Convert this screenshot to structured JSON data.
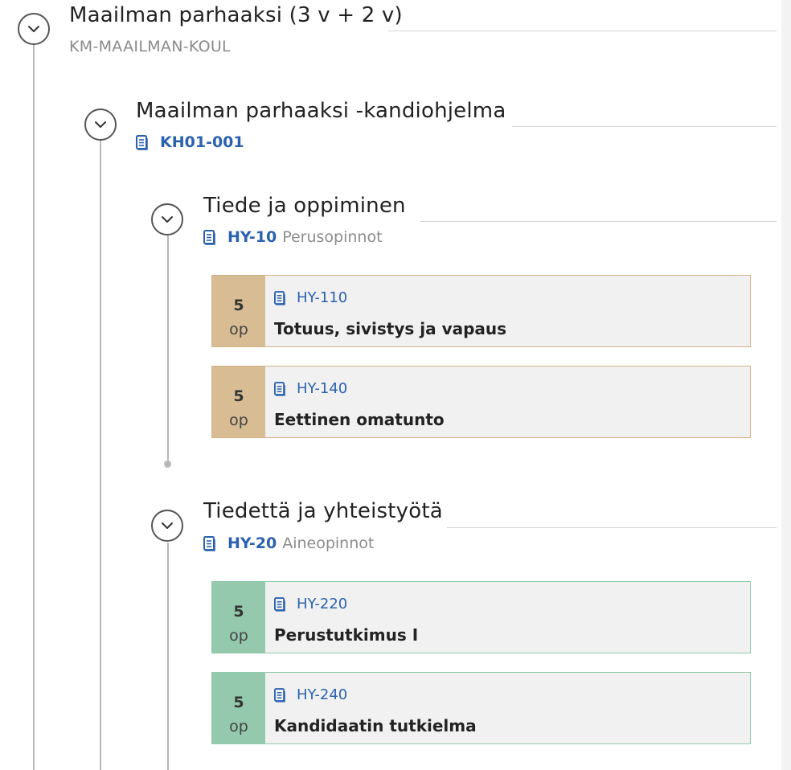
{
  "programme": {
    "title": "Maailman parhaaksi (3 v + 2 v)",
    "code": "KM-MAAILMAN-KOUL"
  },
  "degree": {
    "title": "Maailman parhaaksi -kandiohjelma",
    "code": "KH01-001"
  },
  "modules": [
    {
      "title": "Tiede ja oppiminen",
      "code": "HY-10",
      "type": "Perusopinnot",
      "courses": [
        {
          "credits": "5",
          "unit": "op",
          "code": "HY-110",
          "name": "Totuus, sivistys ja vapaus"
        },
        {
          "credits": "5",
          "unit": "op",
          "code": "HY-140",
          "name": "Eettinen omatunto"
        }
      ]
    },
    {
      "title": "Tiedettä ja yhteistyötä",
      "code": "HY-20",
      "type": "Aineopinnot",
      "courses": [
        {
          "credits": "5",
          "unit": "op",
          "code": "HY-220",
          "name": "Perustutkimus I"
        },
        {
          "credits": "5",
          "unit": "op",
          "code": "HY-240",
          "name": "Kandidaatin tutkielma"
        }
      ]
    }
  ],
  "colors": {
    "link": "#2b62b0",
    "basic_studies": "#d7bc94",
    "intermediate_studies": "#94c9ad"
  }
}
